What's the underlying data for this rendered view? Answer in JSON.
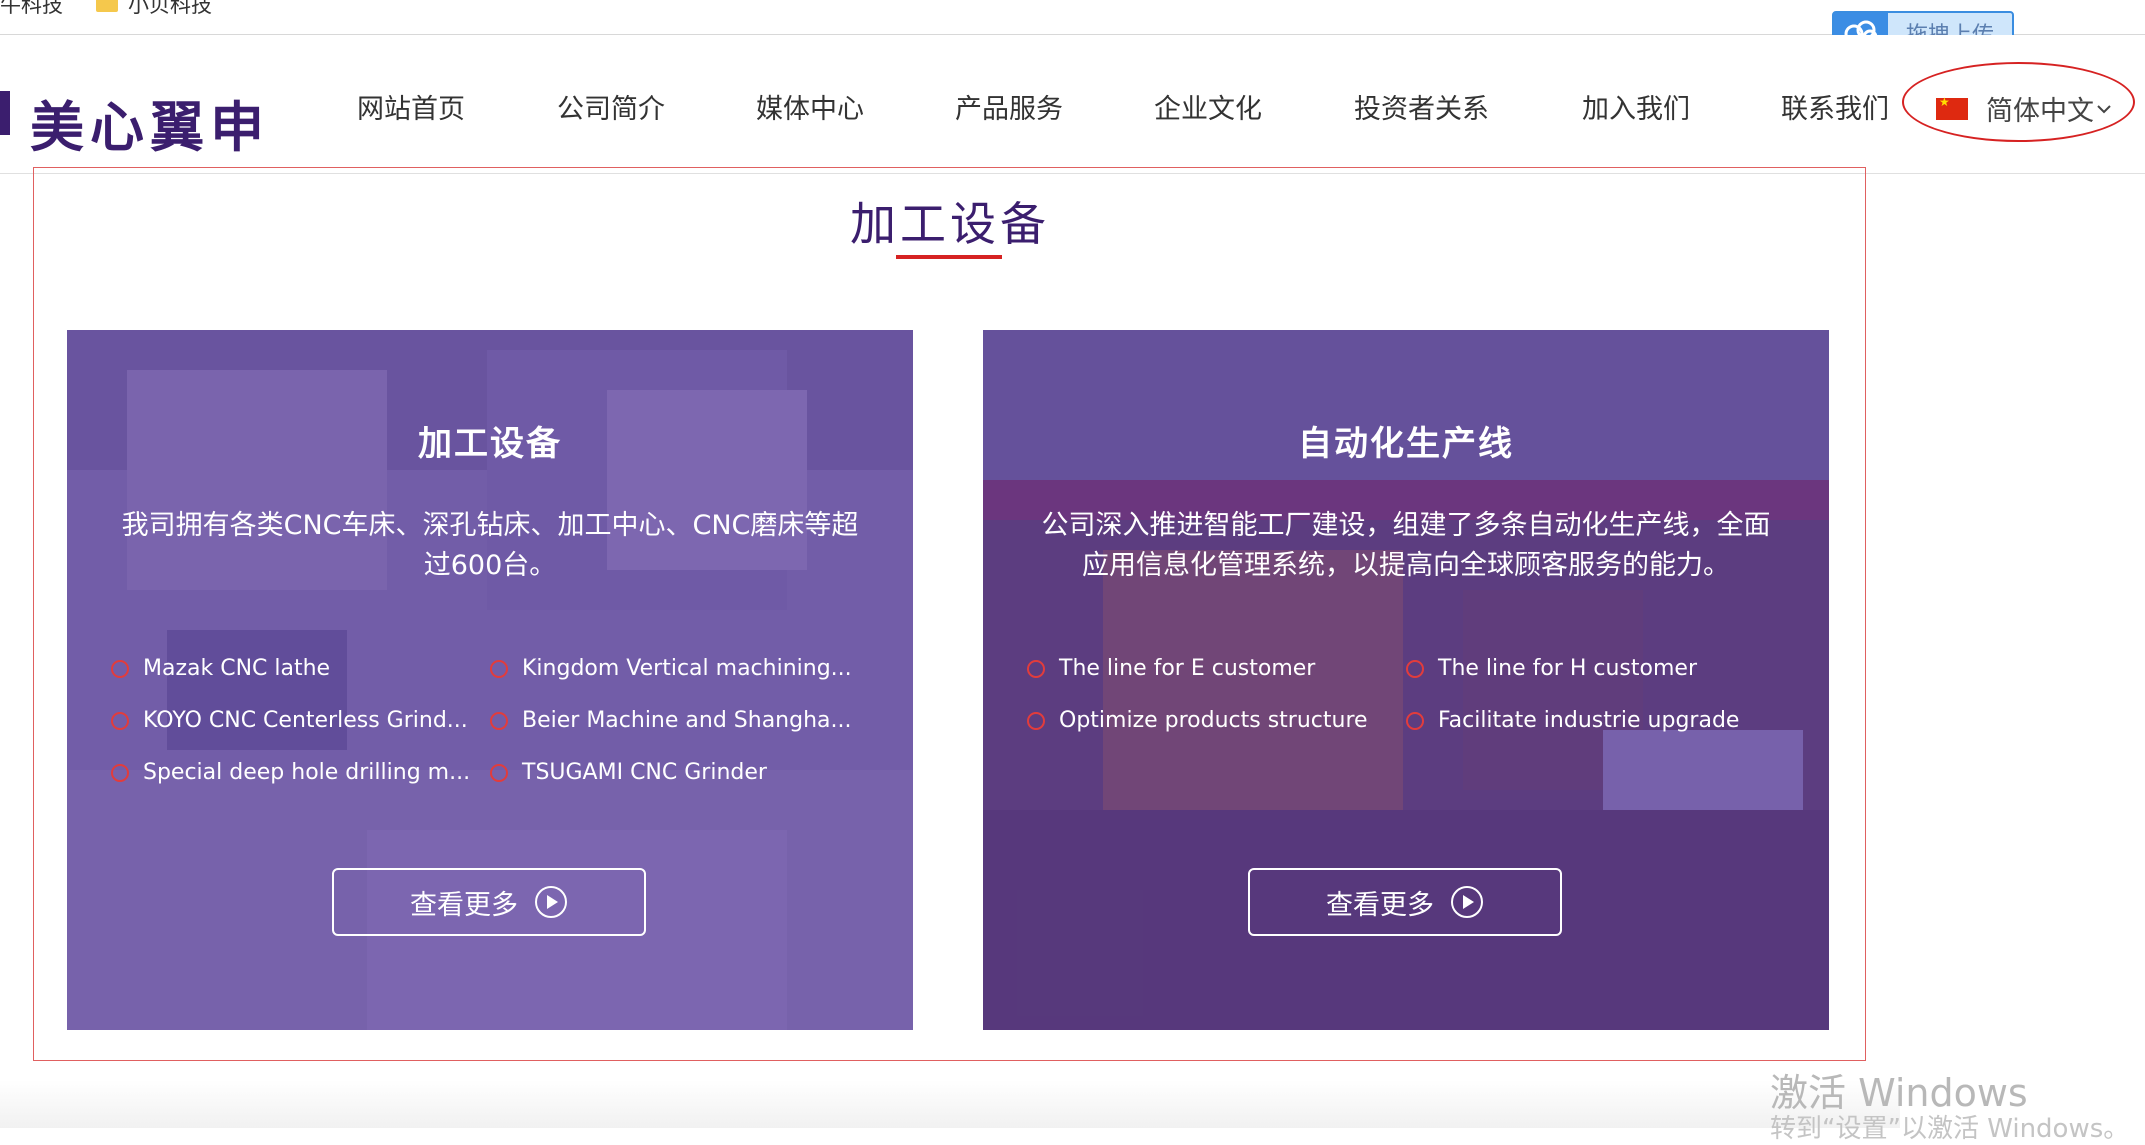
{
  "bookmarks": [
    {
      "label": "牛科技"
    },
    {
      "label": "小贝科技"
    }
  ],
  "upload_widget": {
    "label": "拖拽上传"
  },
  "header": {
    "logo_text": "美心翼申",
    "nav": [
      {
        "label": "网站首页"
      },
      {
        "label": "公司简介"
      },
      {
        "label": "媒体中心"
      },
      {
        "label": "产品服务"
      },
      {
        "label": "企业文化"
      },
      {
        "label": "投资者关系"
      },
      {
        "label": "加入我们"
      },
      {
        "label": "联系我们"
      }
    ],
    "language": {
      "label": "简体中文"
    }
  },
  "section": {
    "title": "加工设备"
  },
  "cards": [
    {
      "title": "加工设备",
      "desc": "我司拥有各类CNC车床、深孔钻床、加工中心、CNC磨床等超过600台。",
      "items": [
        "Mazak CNC lathe",
        "Kingdom Vertical machining...",
        "KOYO CNC Centerless Grind...",
        "Beier Machine and Shangha...",
        "Special deep hole drilling m...",
        "TSUGAMI CNC Grinder"
      ],
      "button": "查看更多"
    },
    {
      "title": "自动化生产线",
      "desc": "公司深入推进智能工厂建设，组建了多条自动化生产线，全面应用信息化管理系统，以提高向全球顾客服务的能力。",
      "items": [
        "The line for E customer",
        "The line for H customer",
        "Optimize products structure",
        "Facilitate industrie upgrade"
      ],
      "button": "查看更多"
    }
  ],
  "watermark": {
    "line1": "激活 Windows",
    "line2": "转到“设置”以激活 Windows。"
  },
  "colors": {
    "brand_purple": "#3b1e6e",
    "accent_red": "#d62222",
    "overlay": "#5a3a99"
  }
}
